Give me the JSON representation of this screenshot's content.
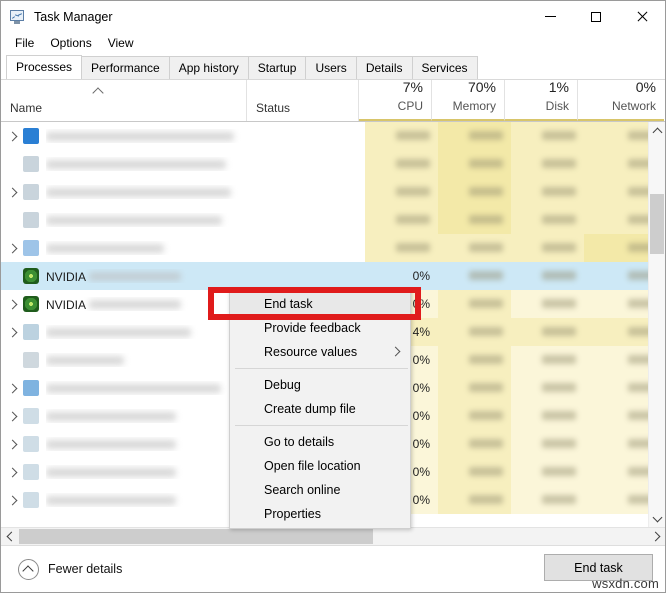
{
  "window": {
    "title": "Task Manager",
    "icon": "task-manager-icon",
    "controls": {
      "minimize": "—",
      "maximize": "□",
      "close": "✕"
    }
  },
  "menubar": {
    "items": [
      "File",
      "Options",
      "View"
    ]
  },
  "tabs": {
    "active": "Processes",
    "items": [
      "Processes",
      "Performance",
      "App history",
      "Startup",
      "Users",
      "Details",
      "Services"
    ]
  },
  "columns": [
    {
      "key": "name",
      "label": "Name",
      "pct": "",
      "align": "left",
      "sorted": true
    },
    {
      "key": "status",
      "label": "Status",
      "pct": "",
      "align": "left",
      "sorted": false
    },
    {
      "key": "cpu",
      "label": "CPU",
      "pct": "7%",
      "align": "right",
      "sorted": false
    },
    {
      "key": "memory",
      "label": "Memory",
      "pct": "70%",
      "align": "right",
      "sorted": false
    },
    {
      "key": "disk",
      "label": "Disk",
      "pct": "1%",
      "align": "right",
      "sorted": false
    },
    {
      "key": "network",
      "label": "Network",
      "pct": "0%",
      "align": "right",
      "sorted": false
    }
  ],
  "rows": [
    {
      "expandable": true,
      "icon_color": "#2a7fd4",
      "name": "",
      "name_redacted": true,
      "name_width": 188,
      "status": "",
      "cpu": "",
      "memory": "",
      "disk": "",
      "network": "",
      "redacted_values": true,
      "heat": [
        2,
        3,
        2,
        2
      ],
      "selected": false
    },
    {
      "expandable": false,
      "icon_color": "#c9d4dc",
      "name": "",
      "name_redacted": true,
      "name_width": 180,
      "status": "",
      "cpu": "",
      "memory": "",
      "disk": "",
      "network": "",
      "redacted_values": true,
      "heat": [
        2,
        3,
        2,
        2
      ],
      "selected": false
    },
    {
      "expandable": true,
      "icon_color": "#c9d4dc",
      "name": "",
      "name_redacted": true,
      "name_width": 185,
      "status": "",
      "cpu": "",
      "memory": "",
      "disk": "",
      "network": "",
      "redacted_values": true,
      "heat": [
        2,
        3,
        2,
        2
      ],
      "selected": false
    },
    {
      "expandable": false,
      "icon_color": "#c9d4dc",
      "name": "",
      "name_redacted": true,
      "name_width": 176,
      "status": "",
      "cpu": "",
      "memory": "",
      "disk": "",
      "network": "",
      "redacted_values": true,
      "heat": [
        2,
        3,
        2,
        2
      ],
      "selected": false
    },
    {
      "expandable": true,
      "icon_color": "#9ec4e8",
      "name": "",
      "name_redacted": true,
      "name_width": 118,
      "status": "",
      "cpu": "",
      "memory": "",
      "disk": "",
      "network": "",
      "redacted_values": true,
      "heat": [
        2,
        2,
        2,
        3
      ],
      "selected": false
    },
    {
      "expandable": false,
      "icon_color": "#2f7d32",
      "name": "NVIDIA",
      "name_redacted": true,
      "name_width": 92,
      "status": "",
      "cpu": "0%",
      "memory": "",
      "disk": "",
      "network": "",
      "redacted_values": true,
      "heat": [
        1,
        1,
        1,
        1
      ],
      "selected": true
    },
    {
      "expandable": true,
      "icon_color": "#2f7d32",
      "name": "NVIDIA",
      "name_redacted": true,
      "name_width": 92,
      "status": "",
      "cpu": "0%",
      "memory": "",
      "disk": "",
      "network": "",
      "redacted_values": true,
      "heat": [
        1,
        2,
        1,
        1
      ],
      "selected": false
    },
    {
      "expandable": true,
      "icon_color": "#bcd2e0",
      "name": "",
      "name_redacted": true,
      "name_width": 145,
      "status": "",
      "cpu": "4%",
      "memory": "",
      "disk": "",
      "network": "",
      "redacted_values": true,
      "heat": [
        2,
        2,
        2,
        2
      ],
      "selected": false
    },
    {
      "expandable": false,
      "icon_color": "#cfd8de",
      "name": "",
      "name_redacted": true,
      "name_width": 78,
      "status": "",
      "cpu": "0%",
      "memory": "",
      "disk": "",
      "network": "",
      "redacted_values": true,
      "heat": [
        1,
        2,
        1,
        1
      ],
      "selected": false
    },
    {
      "expandable": true,
      "icon_color": "#7fb3e0",
      "name": "",
      "name_redacted": true,
      "name_width": 175,
      "status": "",
      "cpu": "0%",
      "memory": "",
      "disk": "",
      "network": "",
      "redacted_values": true,
      "heat": [
        1,
        2,
        1,
        1
      ],
      "selected": false
    },
    {
      "expandable": true,
      "icon_color": "#cfdde6",
      "name": "",
      "name_redacted": true,
      "name_width": 130,
      "status": "",
      "cpu": "0%",
      "memory": "",
      "disk": "",
      "network": "",
      "redacted_values": true,
      "heat": [
        1,
        2,
        1,
        1
      ],
      "selected": false
    },
    {
      "expandable": true,
      "icon_color": "#cfdde6",
      "name": "",
      "name_redacted": true,
      "name_width": 130,
      "status": "",
      "cpu": "0%",
      "memory": "",
      "disk": "",
      "network": "",
      "redacted_values": true,
      "heat": [
        1,
        2,
        1,
        1
      ],
      "selected": false
    },
    {
      "expandable": true,
      "icon_color": "#cfdde6",
      "name": "",
      "name_redacted": true,
      "name_width": 130,
      "status": "",
      "cpu": "0%",
      "memory": "",
      "disk": "",
      "network": "",
      "redacted_values": true,
      "heat": [
        1,
        2,
        1,
        1
      ],
      "selected": false
    },
    {
      "expandable": true,
      "icon_color": "#cfdde6",
      "name": "",
      "name_redacted": true,
      "name_width": 130,
      "status": "",
      "cpu": "0%",
      "memory": "",
      "disk": "",
      "network": "",
      "redacted_values": true,
      "heat": [
        1,
        2,
        1,
        1
      ],
      "selected": false
    }
  ],
  "context_menu": {
    "items": [
      {
        "label": "End task",
        "submenu": false,
        "highlighted": true
      },
      {
        "label": "Provide feedback",
        "submenu": false,
        "highlighted": false
      },
      {
        "label": "Resource values",
        "submenu": true,
        "highlighted": false
      },
      {
        "separator": true
      },
      {
        "label": "Debug",
        "submenu": false,
        "highlighted": false
      },
      {
        "label": "Create dump file",
        "submenu": false,
        "highlighted": false
      },
      {
        "separator": true
      },
      {
        "label": "Go to details",
        "submenu": false,
        "highlighted": false
      },
      {
        "label": "Open file location",
        "submenu": false,
        "highlighted": false
      },
      {
        "label": "Search online",
        "submenu": false,
        "highlighted": false
      },
      {
        "label": "Properties",
        "submenu": false,
        "highlighted": false
      }
    ]
  },
  "annotation": {
    "color": "#e01b1b",
    "target": "End task"
  },
  "bottom": {
    "fewer_details_label": "Fewer details",
    "fewer_details_icon": "chevron-up-circle-icon",
    "end_task_label": "End task"
  },
  "watermark": "wsxdn.com"
}
